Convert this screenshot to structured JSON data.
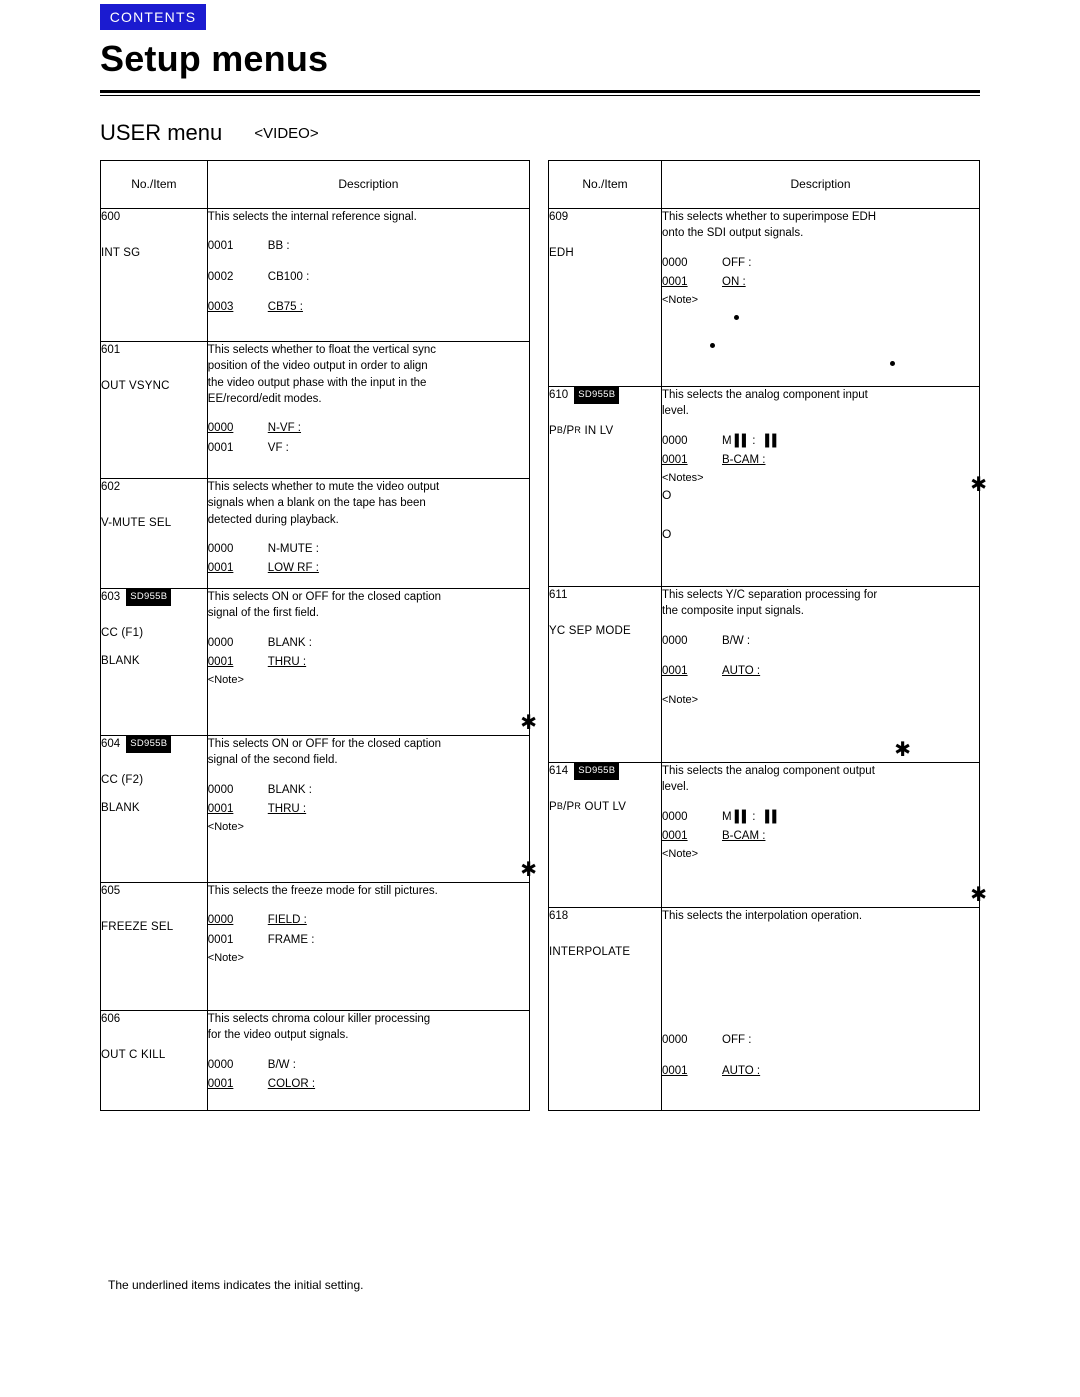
{
  "header": {
    "contents_tab": "CONTENTS",
    "page_title": "Setup menus",
    "menu_heading": "USER menu",
    "menu_sub": "<VIDEO>"
  },
  "columns": {
    "no_item": "No./Item",
    "description": "Description"
  },
  "footnote": "The underlined items indicates the initial setting.",
  "left_rows": [
    {
      "no": "600",
      "item": "INT SG",
      "badge": "",
      "desc": [
        "This selects the internal reference signal."
      ],
      "options": [
        {
          "code": "0001",
          "code_u": false,
          "val": "BB :",
          "val_u": false
        },
        {
          "code": "0002",
          "code_u": false,
          "val": "CB100 :",
          "val_u": false
        },
        {
          "code": "0003",
          "code_u": true,
          "val": "CB75 :",
          "val_u": true
        }
      ],
      "note": ""
    },
    {
      "no": "601",
      "item": "OUT VSYNC",
      "badge": "",
      "desc": [
        "This selects whether to float the vertical sync",
        "position of the video output in order to align",
        "the video output phase with the input in the",
        "EE/record/edit modes."
      ],
      "options": [
        {
          "code": "0000",
          "code_u": true,
          "val": "N-VF :",
          "val_u": true
        },
        {
          "code": "0001",
          "code_u": false,
          "val": "VF :",
          "val_u": false
        }
      ],
      "note": ""
    },
    {
      "no": "602",
      "item": "V-MUTE SEL",
      "badge": "",
      "desc": [
        "This selects whether to mute the video output",
        "signals when a blank on the tape has been",
        "detected during playback."
      ],
      "options": [
        {
          "code": "0000",
          "code_u": false,
          "val": "N-MUTE :",
          "val_u": false
        },
        {
          "code": "0001",
          "code_u": true,
          "val": "LOW RF :",
          "val_u": true
        }
      ],
      "note": ""
    },
    {
      "no": "603",
      "item": "CC (F1)",
      "item2": "BLANK",
      "badge": "SD955B",
      "desc": [
        "This selects ON or OFF for the closed caption",
        "signal of the first field."
      ],
      "options": [
        {
          "code": "0000",
          "code_u": false,
          "val": "BLANK :",
          "val_u": false
        },
        {
          "code": "0001",
          "code_u": true,
          "val": "THRU :",
          "val_u": true
        }
      ],
      "note": "<Note>",
      "asterisk": true
    },
    {
      "no": "604",
      "item": "CC (F2)",
      "item2": "BLANK",
      "badge": "SD955B",
      "desc": [
        "This selects ON or OFF for the closed caption",
        "signal of the second field."
      ],
      "options": [
        {
          "code": "0000",
          "code_u": false,
          "val": "BLANK :",
          "val_u": false
        },
        {
          "code": "0001",
          "code_u": true,
          "val": "THRU :",
          "val_u": true
        }
      ],
      "note": "<Note>",
      "asterisk": true
    },
    {
      "no": "605",
      "item": "FREEZE SEL",
      "badge": "",
      "desc": [
        "This selects the freeze mode for still pictures."
      ],
      "options": [
        {
          "code": "0000",
          "code_u": true,
          "val": "FIELD :",
          "val_u": true
        },
        {
          "code": "0001",
          "code_u": false,
          "val": "FRAME :",
          "val_u": false
        }
      ],
      "note": "<Note>"
    },
    {
      "no": "606",
      "item": "OUT C KILL",
      "badge": "",
      "desc": [
        "This selects chroma colour killer processing",
        "for the video output signals."
      ],
      "options": [
        {
          "code": "0000",
          "code_u": false,
          "val": "B/W :",
          "val_u": false
        },
        {
          "code": "0001",
          "code_u": true,
          "val": "COLOR :",
          "val_u": true
        }
      ],
      "note": ""
    }
  ],
  "right_rows": [
    {
      "no": "609",
      "item": "EDH",
      "badge": "",
      "desc": [
        "This selects whether to superimpose EDH",
        "onto the SDI output signals."
      ],
      "options": [
        {
          "code": "0000",
          "code_u": false,
          "val": "OFF :",
          "val_u": false
        },
        {
          "code": "0001",
          "code_u": true,
          "val": "ON :",
          "val_u": true
        }
      ],
      "note": "<Note>",
      "dots": true
    },
    {
      "no": "610",
      "item": "PB/PR IN LV",
      "badge": "SD955B",
      "desc": [
        "This selects the analog component input",
        "level."
      ],
      "options": [
        {
          "code": "0000",
          "code_u": false,
          "val": "M II :",
          "val_u": false
        },
        {
          "code": "0001",
          "code_u": true,
          "val": "B-CAM :",
          "val_u": true
        }
      ],
      "note": "<Notes>",
      "circles": true,
      "asterisk": true
    },
    {
      "no": "611",
      "item": "YC SEP MODE",
      "badge": "",
      "desc": [
        "This selects Y/C separation processing for",
        "the composite input signals."
      ],
      "options": [
        {
          "code": "0000",
          "code_u": false,
          "val": "B/W :",
          "val_u": false
        },
        {
          "code": "0001",
          "code_u": true,
          "val": "AUTO :",
          "val_u": true
        }
      ],
      "note": "<Note>",
      "asterisk": true
    },
    {
      "no": "614",
      "item": "PB/PR OUT LV",
      "badge": "SD955B",
      "desc": [
        "This selects the analog component output",
        "level."
      ],
      "options": [
        {
          "code": "0000",
          "code_u": false,
          "val": "M II :",
          "val_u": false
        },
        {
          "code": "0001",
          "code_u": true,
          "val": "B-CAM :",
          "val_u": true
        }
      ],
      "note": "<Note>",
      "asterisk": true
    },
    {
      "no": "618",
      "item": "INTERPOLATE",
      "badge": "",
      "desc": [
        "This selects the interpolation operation."
      ],
      "options": [
        {
          "code": "0000",
          "code_u": false,
          "val": "OFF :",
          "val_u": false
        },
        {
          "code": "0001",
          "code_u": true,
          "val": "AUTO :",
          "val_u": true
        }
      ],
      "note": ""
    }
  ]
}
